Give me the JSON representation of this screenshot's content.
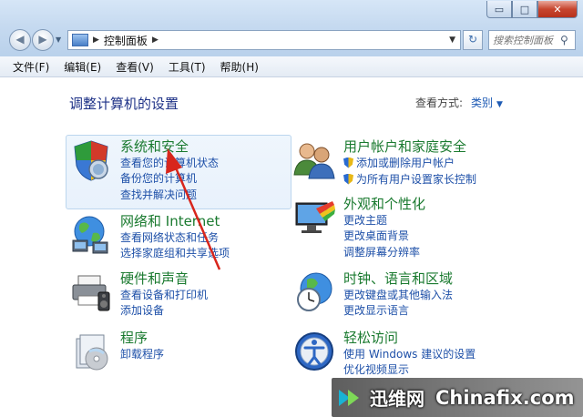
{
  "window": {
    "caption_min": "▭",
    "caption_max": "□",
    "caption_close": "✕"
  },
  "address": {
    "path": "控制面板",
    "search_placeholder": "搜索控制面板"
  },
  "menu": [
    "文件(F)",
    "编辑(E)",
    "查看(V)",
    "工具(T)",
    "帮助(H)"
  ],
  "main": {
    "heading": "调整计算机的设置",
    "view_by_label": "查看方式:",
    "view_by_value": "类别"
  },
  "categories": [
    {
      "title": "系统和安全",
      "icon": "system-security-icon",
      "links": [
        "查看您的计算机状态",
        "备份您的计算机",
        "查找并解决问题"
      ]
    },
    {
      "title": "网络和 Internet",
      "icon": "network-internet-icon",
      "links": [
        "查看网络状态和任务",
        "选择家庭组和共享选项"
      ]
    },
    {
      "title": "硬件和声音",
      "icon": "hardware-sound-icon",
      "links": [
        "查看设备和打印机",
        "添加设备"
      ]
    },
    {
      "title": "程序",
      "icon": "programs-icon",
      "links": [
        "卸载程序"
      ]
    },
    {
      "title": "用户帐户和家庭安全",
      "icon": "user-accounts-icon",
      "links": [
        "添加或删除用户帐户",
        "为所有用户设置家长控制"
      ]
    },
    {
      "title": "外观和个性化",
      "icon": "appearance-icon",
      "links": [
        "更改主题",
        "更改桌面背景",
        "调整屏幕分辨率"
      ]
    },
    {
      "title": "时钟、语言和区域",
      "icon": "clock-region-icon",
      "links": [
        "更改键盘或其他输入法",
        "更改显示语言"
      ]
    },
    {
      "title": "轻松访问",
      "icon": "ease-of-access-icon",
      "links": [
        "使用 Windows 建议的设置",
        "优化视频显示"
      ]
    }
  ],
  "watermark": {
    "cn": "迅维网",
    "en": "Chinafix.com"
  },
  "colors": {
    "category_title": "#1a7a2f",
    "link": "#1e50a8",
    "heading": "#1e3287",
    "annotation_arrow": "#d8261c"
  }
}
